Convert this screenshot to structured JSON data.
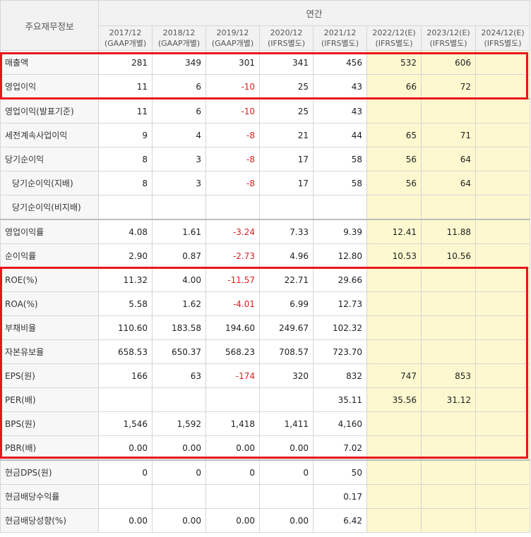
{
  "header": {
    "title": "주요재무정보",
    "annual_label": "연간",
    "years": [
      {
        "period": "2017/12",
        "basis": "(GAAP개별)"
      },
      {
        "period": "2018/12",
        "basis": "(GAAP개별)"
      },
      {
        "period": "2019/12",
        "basis": "(GAAP개별)"
      },
      {
        "period": "2020/12",
        "basis": "(IFRS별도)"
      },
      {
        "period": "2021/12",
        "basis": "(IFRS별도)"
      },
      {
        "period": "2022/12(E)",
        "basis": "(IFRS별도)"
      },
      {
        "period": "2023/12(E)",
        "basis": "(IFRS별도)"
      },
      {
        "period": "2024/12(E)",
        "basis": "(IFRS별도)"
      }
    ]
  },
  "rows": [
    {
      "label": "매출액",
      "values": [
        "281",
        "349",
        "301",
        "341",
        "456",
        "532",
        "606",
        ""
      ]
    },
    {
      "label": "영업이익",
      "values": [
        "11",
        "6",
        "-10",
        "25",
        "43",
        "66",
        "72",
        ""
      ]
    },
    {
      "label": "영업이익(발표기준)",
      "values": [
        "11",
        "6",
        "-10",
        "25",
        "43",
        "",
        "",
        ""
      ]
    },
    {
      "label": "세전계속사업이익",
      "values": [
        "9",
        "4",
        "-8",
        "21",
        "44",
        "65",
        "71",
        ""
      ]
    },
    {
      "label": "당기순이익",
      "values": [
        "8",
        "3",
        "-8",
        "17",
        "58",
        "56",
        "64",
        ""
      ]
    },
    {
      "label": "당기순이익(지배)",
      "values": [
        "8",
        "3",
        "-8",
        "17",
        "58",
        "56",
        "64",
        ""
      ]
    },
    {
      "label": "당기순이익(비지배)",
      "values": [
        "",
        "",
        "",
        "",
        "",
        "",
        "",
        ""
      ]
    },
    {
      "label": "영업이익률",
      "values": [
        "4.08",
        "1.61",
        "-3.24",
        "7.33",
        "9.39",
        "12.41",
        "11.88",
        ""
      ]
    },
    {
      "label": "순이익률",
      "values": [
        "2.90",
        "0.87",
        "-2.73",
        "4.96",
        "12.80",
        "10.53",
        "10.56",
        ""
      ]
    },
    {
      "label": "ROE(%)",
      "values": [
        "11.32",
        "4.00",
        "-11.57",
        "22.71",
        "29.66",
        "",
        "",
        ""
      ]
    },
    {
      "label": "ROA(%)",
      "values": [
        "5.58",
        "1.62",
        "-4.01",
        "6.99",
        "12.73",
        "",
        "",
        ""
      ]
    },
    {
      "label": "부채비율",
      "values": [
        "110.60",
        "183.58",
        "194.60",
        "249.67",
        "102.32",
        "",
        "",
        ""
      ]
    },
    {
      "label": "자본유보율",
      "values": [
        "658.53",
        "650.37",
        "568.23",
        "708.57",
        "723.70",
        "",
        "",
        ""
      ]
    },
    {
      "label": "EPS(원)",
      "values": [
        "166",
        "63",
        "-174",
        "320",
        "832",
        "747",
        "853",
        ""
      ]
    },
    {
      "label": "PER(배)",
      "values": [
        "",
        "",
        "",
        "",
        "35.11",
        "35.56",
        "31.12",
        ""
      ]
    },
    {
      "label": "BPS(원)",
      "values": [
        "1,546",
        "1,592",
        "1,418",
        "1,411",
        "4,160",
        "",
        "",
        ""
      ]
    },
    {
      "label": "PBR(배)",
      "values": [
        "0.00",
        "0.00",
        "0.00",
        "0.00",
        "7.02",
        "",
        "",
        ""
      ]
    },
    {
      "label": "현금DPS(원)",
      "values": [
        "0",
        "0",
        "0",
        "0",
        "50",
        "",
        "",
        ""
      ]
    },
    {
      "label": "현금배당수익률",
      "values": [
        "",
        "",
        "",
        "",
        "0.17",
        "",
        "",
        ""
      ]
    },
    {
      "label": "현금배당성향(%)",
      "values": [
        "0.00",
        "0.00",
        "0.00",
        "0.00",
        "6.42",
        "",
        "",
        ""
      ]
    }
  ],
  "colors": {
    "highlight_border": "#e8161e",
    "estimate_bg": "#fdf8cf",
    "negative_text": "#e02020"
  }
}
